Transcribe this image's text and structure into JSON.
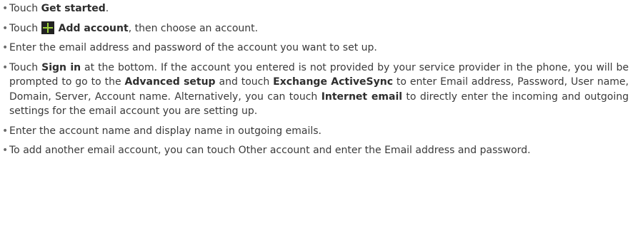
{
  "bullet": "•",
  "steps": [
    {
      "pre": "Touch ",
      "bold": "Get started",
      "post": "."
    },
    {
      "pre": "Touch ",
      "icon": "add-icon",
      "bold": "Add account",
      "post": ", then choose an account."
    },
    {
      "text": "Enter the email address and password of the account you want to set up."
    },
    {
      "pre": "Touch ",
      "bold1": "Sign in",
      "mid1": " at the bottom. If the account you entered is not provided by your service provider in the phone, you will be prompted to go to the ",
      "bold2": "Advanced setup",
      "mid2": " and touch ",
      "bold3": "Exchange ActiveSync",
      "mid3": " to enter Email address, Password, User name, Domain, Server, Account name. Alternatively, you can touch ",
      "bold4": "Internet email",
      "post": " to directly enter the incoming and outgoing settings for the email account you are setting up."
    },
    {
      "text": "Enter the account name and display name in outgoing emails."
    },
    {
      "text": "To add another email account, you can touch Other account and enter the Email address and password."
    }
  ]
}
